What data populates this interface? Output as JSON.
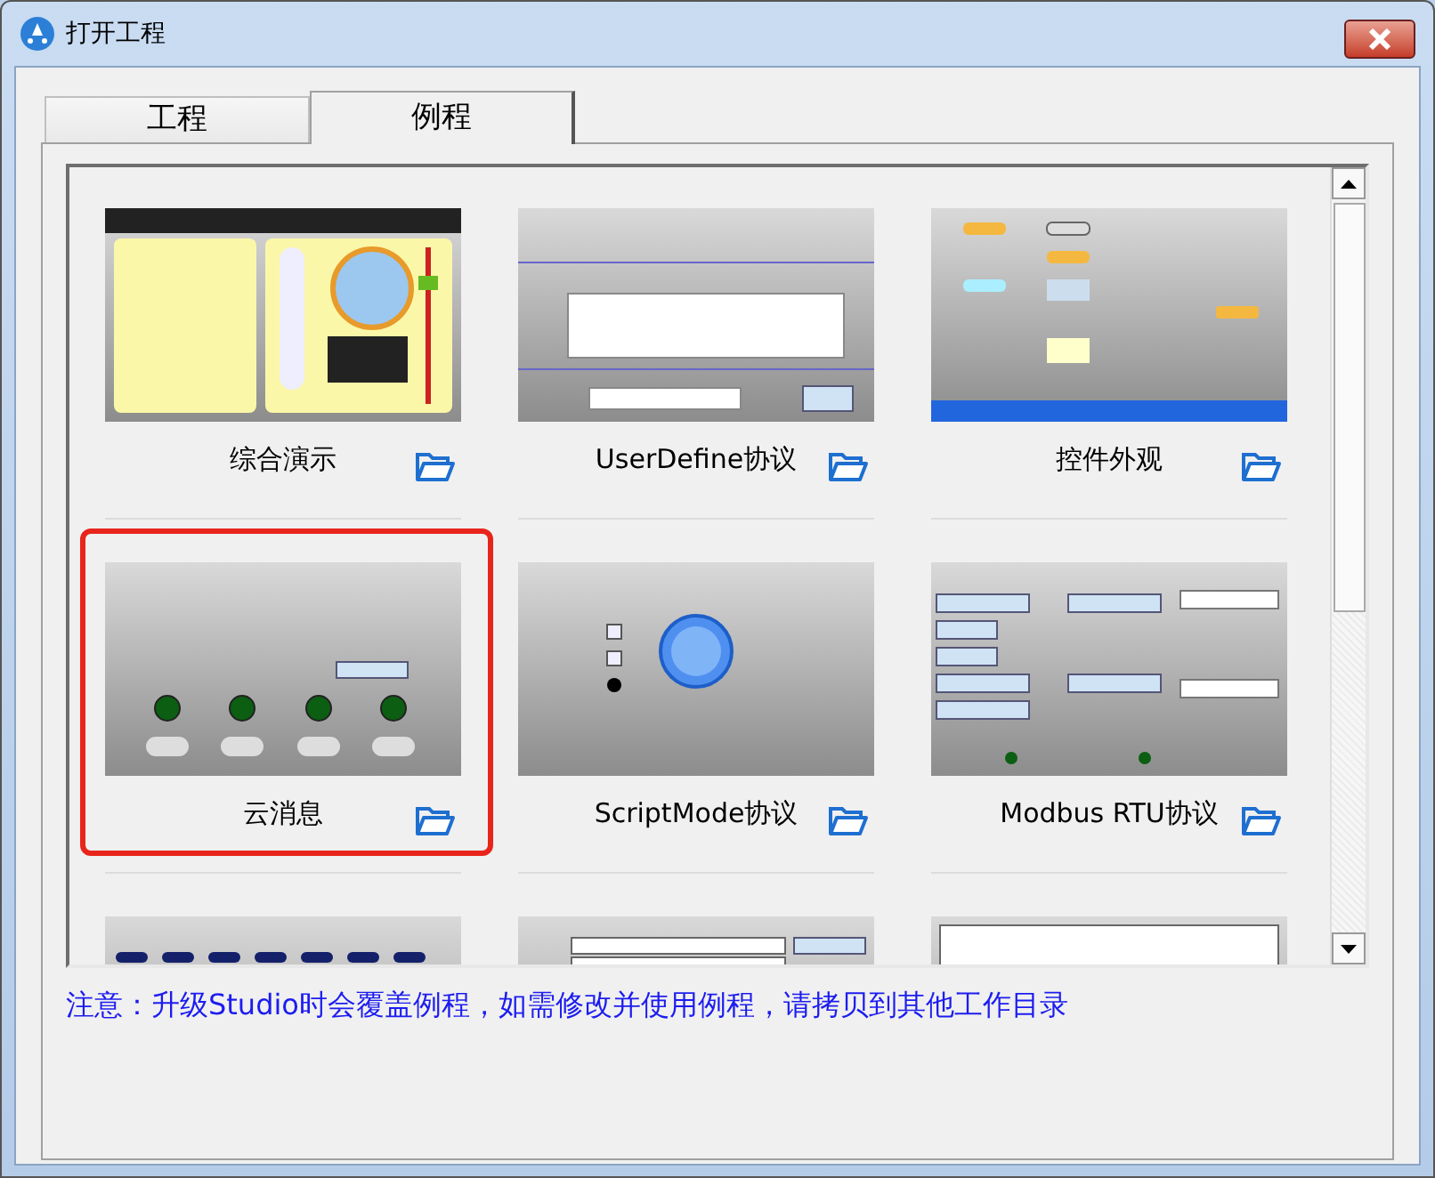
{
  "window": {
    "title": "打开工程"
  },
  "tabs": [
    {
      "label": "工程",
      "selected": false
    },
    {
      "label": "例程",
      "selected": true
    }
  ],
  "examples": [
    {
      "title": "综合演示",
      "selected": false
    },
    {
      "title": "UserDefine协议",
      "selected": false
    },
    {
      "title": "控件外观",
      "selected": false
    },
    {
      "title": "云消息",
      "selected": true
    },
    {
      "title": "ScriptMode协议",
      "selected": false
    },
    {
      "title": "Modbus RTU协议",
      "selected": false
    },
    {
      "kind": "picture"
    },
    {
      "kind": "picture"
    },
    {
      "kind": "picture"
    }
  ],
  "note": "注意：升级Studio时会覆盖例程，如需修改并使用例程，请拷贝到其他工作目录"
}
